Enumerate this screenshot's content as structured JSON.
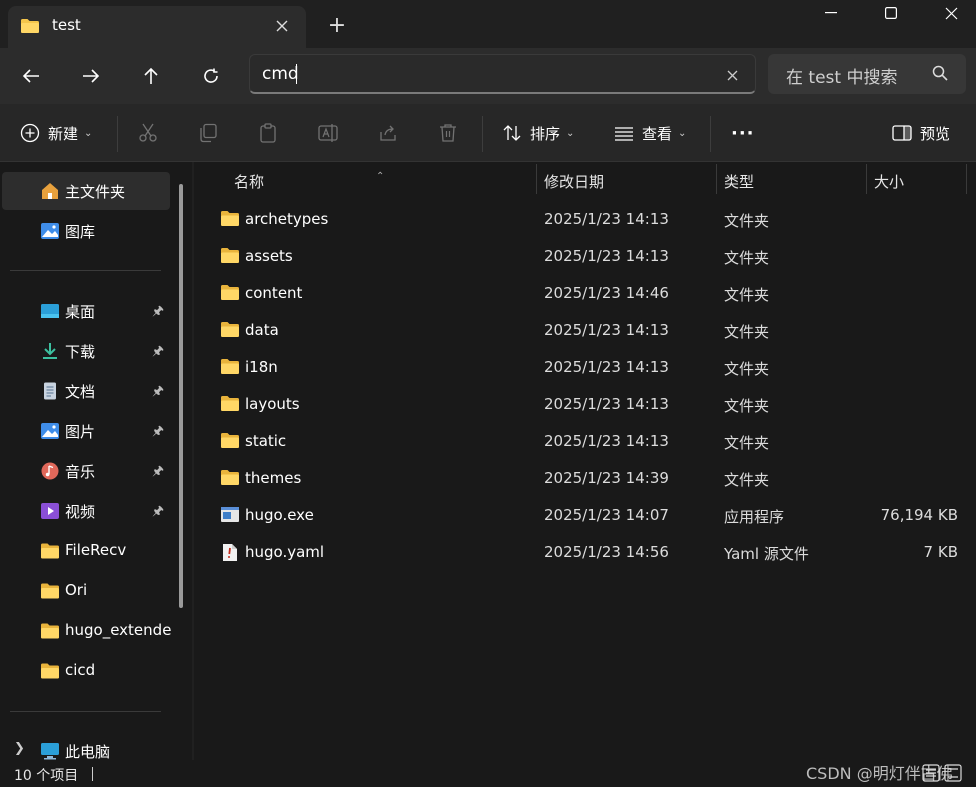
{
  "window": {
    "tab_title": "test",
    "tab_close_icon": "close-icon",
    "new_tab_label": "+",
    "minimize_icon": "minimize-icon",
    "maximize_icon": "maximize-icon",
    "close_icon": "close-icon"
  },
  "navigation": {
    "back_icon": "arrow-left-icon",
    "forward_icon": "arrow-right-icon",
    "up_icon": "arrow-up-icon",
    "refresh_icon": "refresh-icon",
    "address_value": "cmd",
    "search_placeholder": "在 test 中搜索"
  },
  "toolbar": {
    "new_label": "新建",
    "sort_label": "排序",
    "view_label": "查看",
    "more_label": "···",
    "preview_label": "预览",
    "disabled_icons": [
      "cut-icon",
      "copy-icon",
      "paste-icon",
      "rename-icon",
      "share-icon",
      "delete-icon"
    ]
  },
  "sidebar": {
    "items": [
      {
        "label": "主文件夹",
        "icon": "home-icon",
        "pinned": false,
        "active": true
      },
      {
        "label": "图库",
        "icon": "gallery-icon",
        "pinned": false
      },
      {
        "label": "桌面",
        "icon": "desktop-icon",
        "pinned": true
      },
      {
        "label": "下载",
        "icon": "download-icon",
        "pinned": true
      },
      {
        "label": "文档",
        "icon": "document-icon",
        "pinned": true
      },
      {
        "label": "图片",
        "icon": "pictures-icon",
        "pinned": true
      },
      {
        "label": "音乐",
        "icon": "music-icon",
        "pinned": true
      },
      {
        "label": "视频",
        "icon": "video-icon",
        "pinned": true
      },
      {
        "label": "FileRecv",
        "icon": "folder-icon",
        "pinned": false
      },
      {
        "label": "Ori",
        "icon": "folder-icon",
        "pinned": false
      },
      {
        "label": "hugo_extende",
        "icon": "folder-icon",
        "pinned": false
      },
      {
        "label": "cicd",
        "icon": "folder-icon",
        "pinned": false
      },
      {
        "label": "此电脑",
        "icon": "computer-icon",
        "pinned": false
      }
    ]
  },
  "columns": {
    "name": "名称",
    "date": "修改日期",
    "type": "类型",
    "size": "大小"
  },
  "files": [
    {
      "name": "archetypes",
      "date": "2025/1/23 14:13",
      "type": "文件夹",
      "size": "",
      "icon": "folder-icon"
    },
    {
      "name": "assets",
      "date": "2025/1/23 14:13",
      "type": "文件夹",
      "size": "",
      "icon": "folder-icon"
    },
    {
      "name": "content",
      "date": "2025/1/23 14:46",
      "type": "文件夹",
      "size": "",
      "icon": "folder-icon"
    },
    {
      "name": "data",
      "date": "2025/1/23 14:13",
      "type": "文件夹",
      "size": "",
      "icon": "folder-icon"
    },
    {
      "name": "i18n",
      "date": "2025/1/23 14:13",
      "type": "文件夹",
      "size": "",
      "icon": "folder-icon"
    },
    {
      "name": "layouts",
      "date": "2025/1/23 14:13",
      "type": "文件夹",
      "size": "",
      "icon": "folder-icon"
    },
    {
      "name": "static",
      "date": "2025/1/23 14:13",
      "type": "文件夹",
      "size": "",
      "icon": "folder-icon"
    },
    {
      "name": "themes",
      "date": "2025/1/23 14:39",
      "type": "文件夹",
      "size": "",
      "icon": "folder-icon"
    },
    {
      "name": "hugo.exe",
      "date": "2025/1/23 14:07",
      "type": "应用程序",
      "size": "76,194 KB",
      "icon": "exe-icon"
    },
    {
      "name": "hugo.yaml",
      "date": "2025/1/23 14:56",
      "type": "Yaml 源文件",
      "size": "7 KB",
      "icon": "yaml-file-icon"
    }
  ],
  "status": {
    "item_count": "10 个项目",
    "watermark": "CSDN @明灯伴古佛"
  },
  "colors": {
    "folder": "#f4c54b",
    "background": "#191919",
    "toolbar": "#272727"
  }
}
